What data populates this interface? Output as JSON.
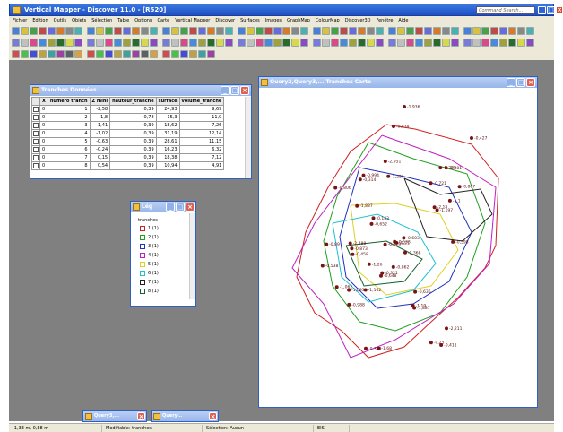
{
  "app": {
    "title": "Vertical Mapper - Discover 11.0 - [R520]",
    "search_placeholder": "Command Search..."
  },
  "menu": [
    "Fichier",
    "Edition",
    "Outils",
    "Objets",
    "Sélection",
    "Table",
    "Options",
    "Carte",
    "Vertical Mapper",
    "Discover",
    "Surfaces",
    "Images",
    "GraphMap",
    "ColourMap",
    "Discover3D",
    "Fenêtre",
    "Aide"
  ],
  "table_window": {
    "title": "Tranches Données",
    "columns": [
      "X",
      "numero tranch",
      "Z mini",
      "hauteur_tranche",
      "surface",
      "volume_tranche"
    ],
    "rows": [
      [
        "0",
        "1",
        "-2,58",
        "0,39",
        "24,93",
        "9,69"
      ],
      [
        "0",
        "2",
        "-1,8",
        "0,78",
        "15,3",
        "11,9"
      ],
      [
        "0",
        "3",
        "-1,41",
        "0,39",
        "18,62",
        "7,26"
      ],
      [
        "0",
        "4",
        "-1,02",
        "0,39",
        "31,19",
        "12,14"
      ],
      [
        "0",
        "5",
        "-0,63",
        "0,39",
        "28,61",
        "11,15"
      ],
      [
        "0",
        "6",
        "-0,24",
        "0,39",
        "16,23",
        "6,32"
      ],
      [
        "0",
        "7",
        "0,15",
        "0,39",
        "18,38",
        "7,12"
      ],
      [
        "0",
        "8",
        "0,54",
        "0,39",
        "10,94",
        "4,91"
      ]
    ]
  },
  "legend_window": {
    "title": "Lég",
    "heading": "tranches",
    "items": [
      {
        "label": "1 (1)",
        "color": "#d02020"
      },
      {
        "label": "2 (1)",
        "color": "#20a020"
      },
      {
        "label": "3 (1)",
        "color": "#2030c0"
      },
      {
        "label": "4 (1)",
        "color": "#c020c0"
      },
      {
        "label": "5 (1)",
        "color": "#e0d020"
      },
      {
        "label": "6 (1)",
        "color": "#20c0d0"
      },
      {
        "label": "7 (1)",
        "color": "#202020"
      },
      {
        "label": "8 (1)",
        "color": "#106030"
      }
    ]
  },
  "map_window": {
    "title": "Query2,Query3,... Tranches Carte",
    "point_labels": [
      "-1,936",
      "-0,834",
      "-0,427",
      "-1,368",
      "-0,994",
      "-0,21",
      "-2,295",
      "-0,321",
      "-1,197",
      "-1,062",
      "-0,458",
      "-1,093",
      "-0,862",
      "-0,806",
      "-0,411",
      "-1,251",
      "-0,363",
      "-0,603",
      "-1,102",
      "-0,887",
      "-2,488",
      "-1,26",
      "-0,721",
      "-0,652",
      "-2,081",
      "-1,1",
      "-0,873",
      "-0,648",
      "-1,887",
      "-0,314",
      "-0,89",
      "-2,951",
      "-0,636",
      "-1,68",
      "-0,533",
      "-0,598",
      "-0,229",
      "-1,887",
      "-0,988",
      "-2,18",
      "-2,211",
      "-0,25",
      "-1,19",
      "-0,538",
      "-0,143"
    ]
  },
  "minimized": [
    {
      "label": "Query3,..."
    },
    {
      "label": "Query..."
    }
  ],
  "status": {
    "coords": "-1,33 m, 0,88 m",
    "editable": "Modifiable: tranches",
    "selection": "Sélection: Aucun",
    "mode": "EIS"
  },
  "colors": {
    "title_blue": "#1d4fc4",
    "workspace_gray": "#808080",
    "point_brown": "#7a1414"
  }
}
